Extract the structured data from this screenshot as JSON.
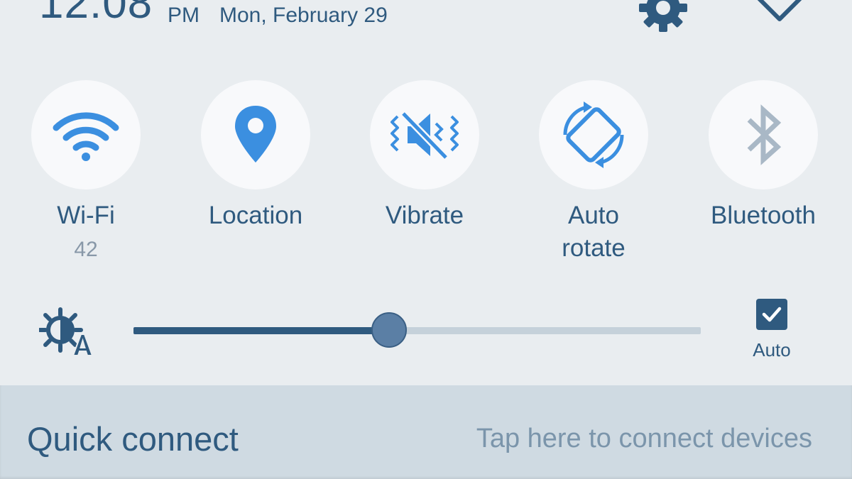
{
  "header": {
    "time": "12:08",
    "ampm": "PM",
    "date": "Mon, February 29",
    "settings_icon": "gear-icon",
    "collapse_icon": "chevron-down-icon"
  },
  "tiles": [
    {
      "label": "Wi-Fi",
      "sub": "42",
      "icon": "wifi-icon",
      "active": true
    },
    {
      "label": "Location",
      "sub": "",
      "icon": "location-pin-icon",
      "active": true
    },
    {
      "label": "Vibrate",
      "sub": "",
      "icon": "vibrate-icon",
      "active": true
    },
    {
      "label": "Auto\nrotate",
      "sub": "",
      "icon": "auto-rotate-icon",
      "active": true
    },
    {
      "label": "Bluetooth",
      "sub": "",
      "icon": "bluetooth-icon",
      "active": false
    }
  ],
  "brightness": {
    "icon": "auto-brightness-icon",
    "level": 0.45,
    "auto_checked": true,
    "auto_label": "Auto"
  },
  "quick_connect": {
    "title": "Quick connect",
    "hint": "Tap here to connect devices"
  },
  "colors": {
    "accent": "#2f5a7f",
    "icon_active": "#3b8fe0",
    "icon_inactive": "#a9b8c6",
    "panel_bg": "#e9edf0",
    "quick_connect_bg": "#cfdae2"
  }
}
